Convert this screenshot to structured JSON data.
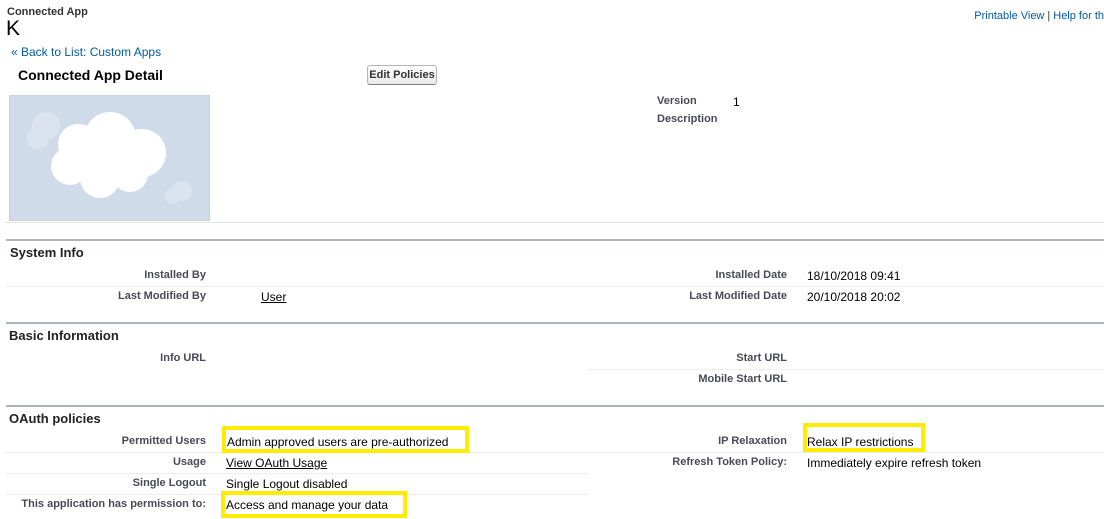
{
  "header": {
    "subtitle": "Connected App",
    "title": "K",
    "back_link": "« Back to List: Custom Apps",
    "printable_view": "Printable View",
    "separator": "|",
    "help": "Help for th"
  },
  "detail": {
    "title": "Connected App Detail",
    "edit_button": "Edit Policies",
    "version_label": "Version",
    "version_value": "1",
    "description_label": "Description"
  },
  "system_info": {
    "title": "System Info",
    "installed_by_label": "Installed By",
    "installed_date_label": "Installed Date",
    "installed_date_value": "18/10/2018 09:41",
    "last_modified_by_label": "Last Modified By",
    "last_modified_by_value": "User",
    "last_modified_date_label": "Last Modified Date",
    "last_modified_date_value": "20/10/2018 20:02"
  },
  "basic_info": {
    "title": "Basic Information",
    "info_url_label": "Info URL",
    "start_url_label": "Start URL",
    "mobile_start_url_label": "Mobile Start URL"
  },
  "oauth": {
    "title": "OAuth policies",
    "permitted_users_label": "Permitted Users",
    "permitted_users_value": "Admin approved users are pre-authorized",
    "ip_relaxation_label": "IP Relaxation",
    "ip_relaxation_value": "Relax IP restrictions",
    "usage_label": "Usage",
    "usage_value": "View OAuth Usage",
    "refresh_label": "Refresh Token Policy:",
    "refresh_value": "Immediately expire refresh token",
    "single_logout_label": "Single Logout",
    "single_logout_value": "Single Logout disabled",
    "permission_label": "This application has permission to:",
    "permission_value": "Access and manage your data"
  },
  "colors": {
    "link": "#015ba7",
    "highlight": "#ffec00",
    "section_rule": "#a9b4be",
    "logo_bg": "#cfdbe8"
  }
}
